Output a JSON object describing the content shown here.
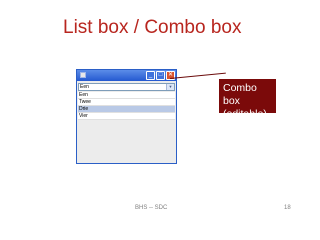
{
  "slide": {
    "title": "List box / Combo box",
    "footer": "BHS -- SDC",
    "page_number": "18"
  },
  "window": {
    "buttons": {
      "minimize": "_",
      "maximize": "□",
      "close": "✕"
    },
    "combo": {
      "value": "Een",
      "arrow": "▼"
    },
    "list": {
      "items": [
        "Een",
        "Twee",
        "Drie",
        "Vier"
      ],
      "selected_index": 2
    }
  },
  "callout": {
    "line1": "Combo box",
    "line2": "(editable)"
  }
}
